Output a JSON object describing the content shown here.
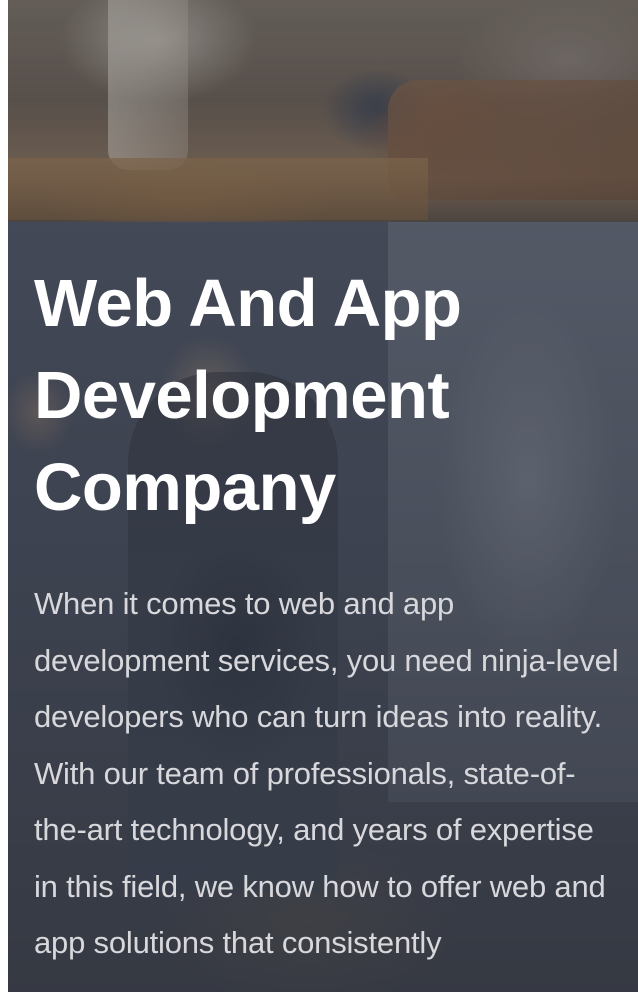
{
  "hero": {
    "title": "Web And App Development Company",
    "description": "When it comes to web and app development services, you need ninja-level developers who can turn ideas into reality. With our team of professionals, state-of-the-art technology, and years of expertise in this field, we know how to offer web and app solutions that consistently"
  },
  "colors": {
    "title_text": "#ffffff",
    "body_text": "#d8d8dc",
    "overlay": "#30364a"
  }
}
